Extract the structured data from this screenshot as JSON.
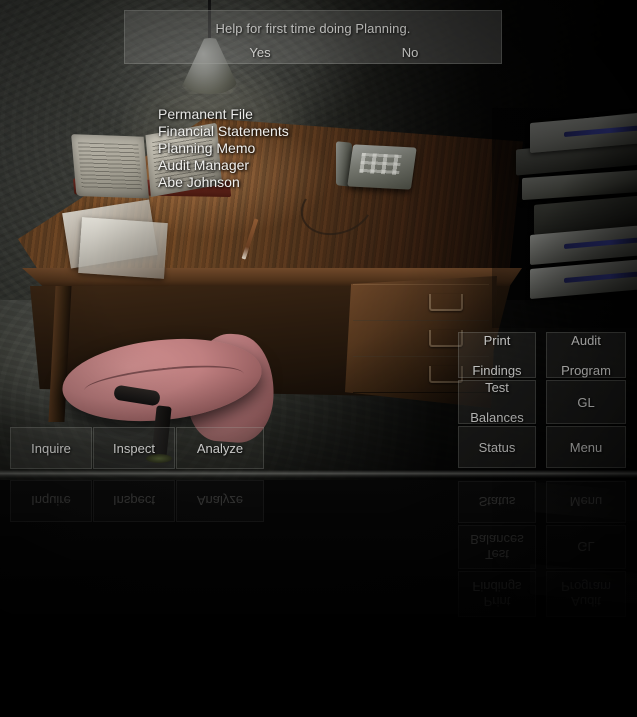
{
  "dialog": {
    "prompt": "Help for first time doing Planning.",
    "yes_label": "Yes",
    "no_label": "No"
  },
  "object_list": {
    "items": [
      {
        "label": "Permanent File"
      },
      {
        "label": "Financial Statements"
      },
      {
        "label": "Planning Memo"
      },
      {
        "label": "Audit Manager"
      },
      {
        "label": "Abe Johnson"
      }
    ]
  },
  "action_bar": {
    "inquire_label": "Inquire",
    "inspect_label": "Inspect",
    "analyze_label": "Analyze"
  },
  "command_panel": {
    "print_findings_line1": "Print",
    "print_findings_line2": "Findings",
    "audit_program_line1": "Audit",
    "audit_program_line2": "Program",
    "test_balances_line1": "Test",
    "test_balances_line2": "Balances",
    "gl_label": "GL",
    "status_label": "Status",
    "menu_label": "Menu"
  },
  "colors": {
    "desk_wood": "#6b4626",
    "chair_upholstery": "#bf7f80",
    "copier_accent": "#4750c4",
    "ui_text": "#f1f1ef",
    "panel_fill": "rgba(150,152,146,.16)"
  }
}
